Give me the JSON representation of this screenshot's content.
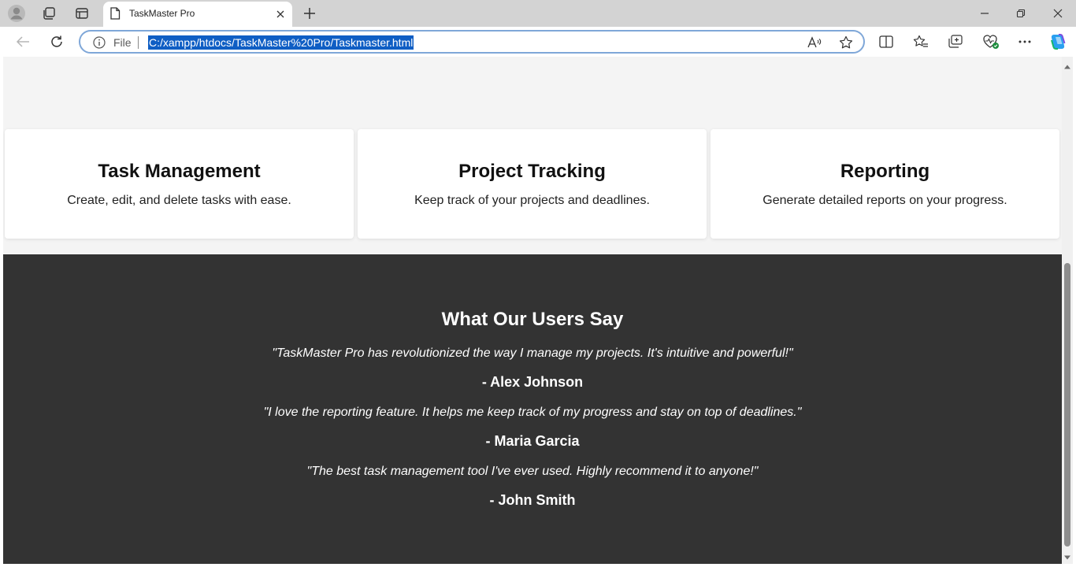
{
  "browser": {
    "tab": {
      "title": "TaskMaster Pro"
    },
    "address_bar": {
      "scheme_label": "File",
      "url": "C:/xampp/htdocs/TaskMaster%20Pro/Taskmaster.html"
    }
  },
  "features": [
    {
      "title": "Task Management",
      "description": "Create, edit, and delete tasks with ease."
    },
    {
      "title": "Project Tracking",
      "description": "Keep track of your projects and deadlines."
    },
    {
      "title": "Reporting",
      "description": "Generate detailed reports on your progress."
    }
  ],
  "testimonials": {
    "heading": "What Our Users Say",
    "items": [
      {
        "quote": "\"TaskMaster Pro has revolutionized the way I manage my projects. It's intuitive and powerful!\"",
        "author": "- Alex Johnson"
      },
      {
        "quote": "\"I love the reporting feature. It helps me keep track of my progress and stay on top of deadlines.\"",
        "author": "- Maria Garcia"
      },
      {
        "quote": "\"The best task management tool I've ever used. Highly recommend it to anyone!\"",
        "author": "- John Smith"
      }
    ]
  },
  "colors": {
    "page_background": "#f4f4f4",
    "card_background": "#ffffff",
    "testimonial_background": "#333333",
    "url_selection": "#0f5ec4"
  }
}
